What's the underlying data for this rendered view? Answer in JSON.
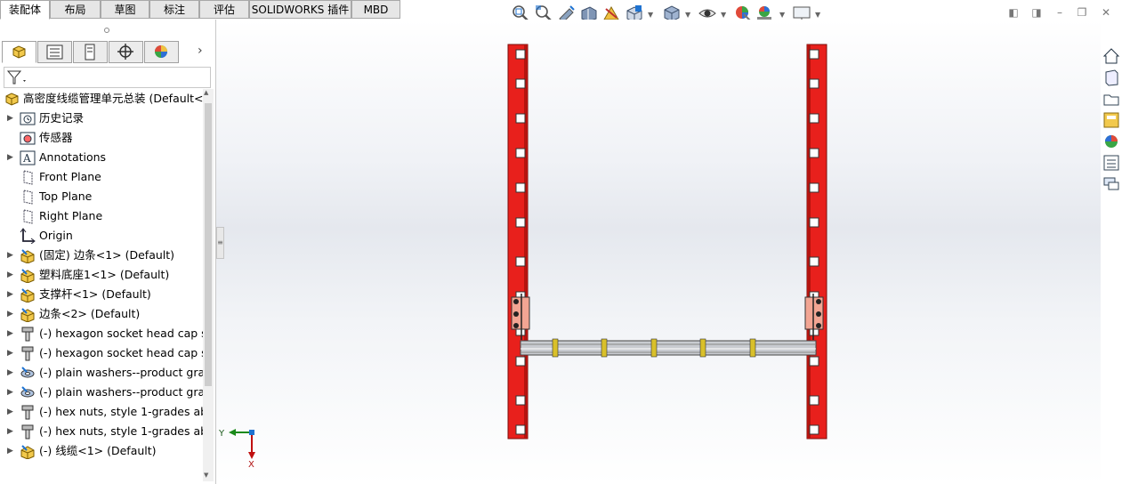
{
  "command_tabs": [
    "装配体",
    "布局",
    "草图",
    "标注",
    "评估",
    "SOLIDWORKS 插件",
    "MBD"
  ],
  "active_tab": "装配体",
  "tree": {
    "root_label": "高密度线缆管理单元总装  (Default<D",
    "items": [
      {
        "label": "历史记录",
        "icon": "history-folder-icon",
        "expand": true
      },
      {
        "label": "传感器",
        "icon": "sensor-icon",
        "expand": false
      },
      {
        "label": "Annotations",
        "icon": "annotations-icon",
        "expand": true
      },
      {
        "label": "Front Plane",
        "icon": "plane-icon",
        "expand": false
      },
      {
        "label": "Top Plane",
        "icon": "plane-icon",
        "expand": false
      },
      {
        "label": "Right Plane",
        "icon": "plane-icon",
        "expand": false
      },
      {
        "label": "Origin",
        "icon": "origin-icon",
        "expand": false
      },
      {
        "label": "(固定) 边条<1> (Default)",
        "icon": "part-icon",
        "expand": true
      },
      {
        "label": "塑料底座1<1> (Default)",
        "icon": "part-icon",
        "expand": true
      },
      {
        "label": "支撑杆<1> (Default)",
        "icon": "part-icon",
        "expand": true
      },
      {
        "label": "边条<2> (Default)",
        "icon": "part-icon",
        "expand": true
      },
      {
        "label": "(-) hexagon socket head cap s",
        "icon": "screw-icon",
        "expand": true
      },
      {
        "label": "(-) hexagon socket head cap s",
        "icon": "screw-icon",
        "expand": true
      },
      {
        "label": "(-) plain washers--product gra",
        "icon": "washer-icon",
        "expand": true
      },
      {
        "label": "(-) plain washers--product gra",
        "icon": "washer-icon",
        "expand": true
      },
      {
        "label": "(-) hex nuts, style 1-grades ab",
        "icon": "screw-icon",
        "expand": true
      },
      {
        "label": "(-) hex nuts, style 1-grades ab",
        "icon": "screw-icon",
        "expand": true
      },
      {
        "label": "(-) 线缆<1> (Default)",
        "icon": "part-icon",
        "expand": true
      }
    ]
  },
  "triad": {
    "y_label": "Y",
    "x_label": "X"
  },
  "colors": {
    "rail_red": "#e8201c",
    "bracket_salmon": "#f2a593",
    "rod_grey": "#c8cbd0",
    "accent_blue": "#1f73d1"
  }
}
